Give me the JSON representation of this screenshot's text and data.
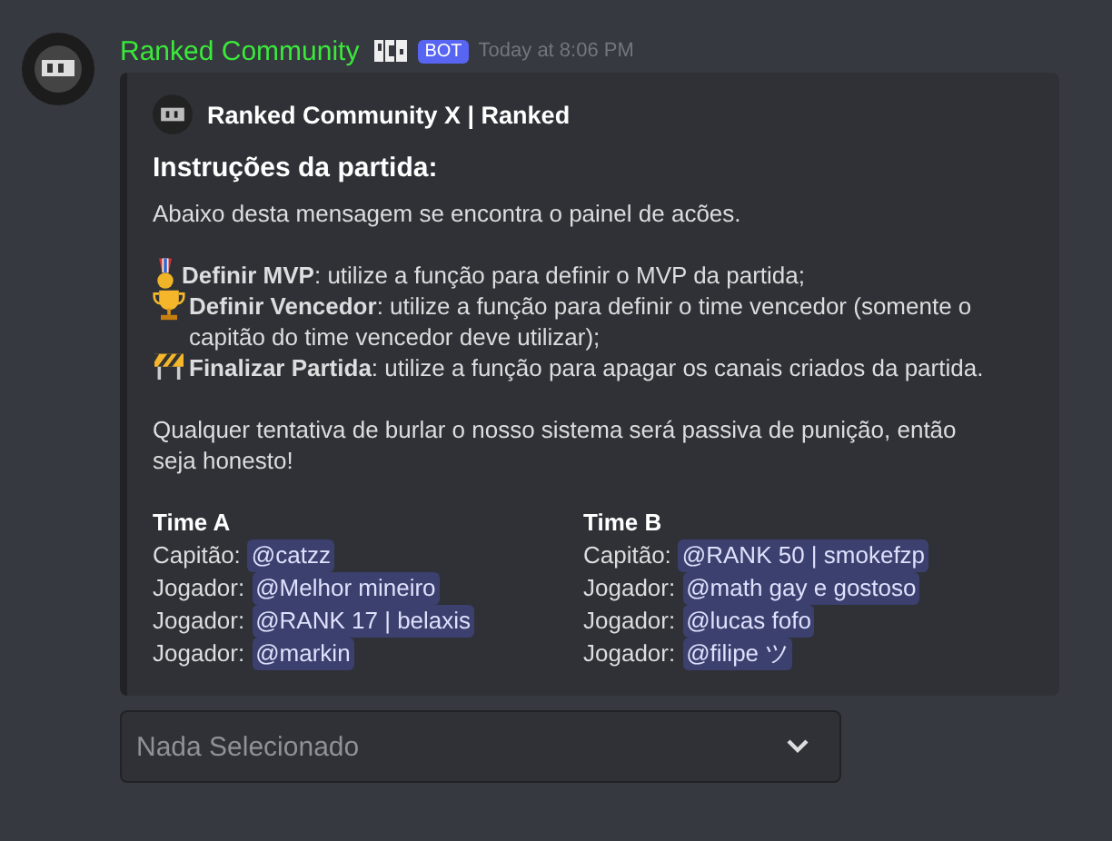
{
  "message": {
    "author": "Ranked Community",
    "badge": "BOT",
    "timestamp": "Today at 8:06 PM"
  },
  "embed": {
    "author": "Ranked Community X | Ranked",
    "title": "Instruções da partida:",
    "description": [
      {
        "kind": "text",
        "text": "Abaixo desta mensagem se encontra o painel de acões."
      },
      {
        "kind": "gap"
      },
      {
        "kind": "medal",
        "text": "**Definir MVP**: utilize a função para definir o MVP da partida;"
      },
      {
        "kind": "trophy",
        "text": "**Definir Vencedor**: utilize a função para definir o time vencedor (somente o capitão do time vencedor deve utilizar);"
      },
      {
        "kind": "barrier",
        "text": "**Finalizar Partida**: utilize a função para apagar os canais criados da partida."
      },
      {
        "kind": "gap"
      },
      {
        "kind": "text",
        "text": "Qualquer tentativa de burlar o nosso sistema será passiva de punição, então seja honesto!"
      }
    ],
    "teams": [
      {
        "name": "Time A",
        "rows": [
          {
            "label": "Capitão:",
            "mention": "@catzz"
          },
          {
            "label": "Jogador:",
            "mention": "@Melhor mineiro"
          },
          {
            "label": "Jogador:",
            "mention": "@RANK 17 | belaxis"
          },
          {
            "label": "Jogador:",
            "mention": "@markin"
          }
        ]
      },
      {
        "name": "Time B",
        "rows": [
          {
            "label": "Capitão:",
            "mention": "@RANK 50 | smokefzp"
          },
          {
            "label": "Jogador:",
            "mention": "@math gay e gostoso"
          },
          {
            "label": "Jogador:",
            "mention": "@lucas fofo"
          },
          {
            "label": "Jogador:",
            "mention": "@filipe ツ"
          }
        ]
      }
    ]
  },
  "select": {
    "placeholder": "Nada Selecionado"
  }
}
